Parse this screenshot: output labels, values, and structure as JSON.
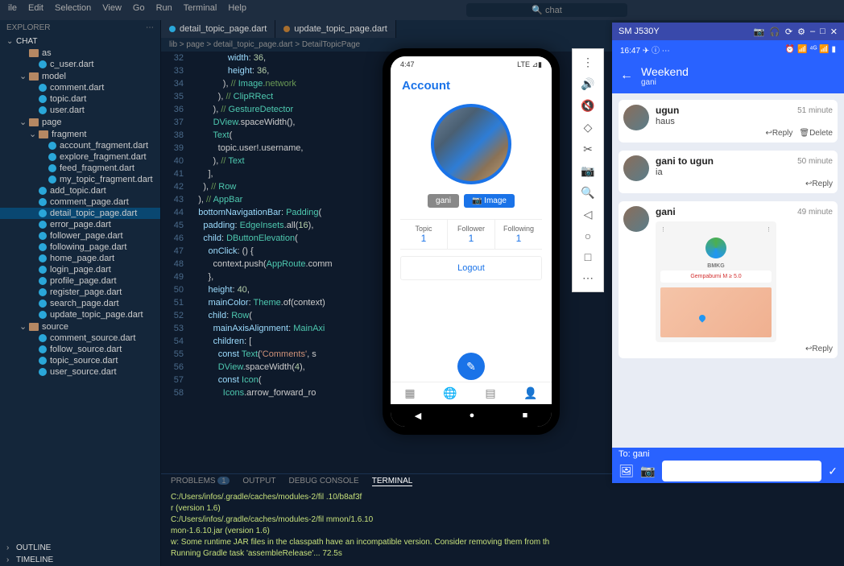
{
  "menubar": {
    "items": [
      "ile",
      "Edit",
      "Selection",
      "View",
      "Go",
      "Run",
      "Terminal",
      "Help"
    ],
    "search": "chat"
  },
  "explorer": {
    "title": "EXPLORER",
    "project": "CHAT",
    "outline": "OUTLINE",
    "timeline": "TIMELINE"
  },
  "tree": [
    {
      "l": "as",
      "ind": 1,
      "icon": "folder"
    },
    {
      "l": "c_user.dart",
      "ind": 2,
      "icon": "dart"
    },
    {
      "l": "model",
      "ind": 1,
      "icon": "folder",
      "chev": "v"
    },
    {
      "l": "comment.dart",
      "ind": 2,
      "icon": "dart"
    },
    {
      "l": "topic.dart",
      "ind": 2,
      "icon": "dart"
    },
    {
      "l": "user.dart",
      "ind": 2,
      "icon": "dart"
    },
    {
      "l": "page",
      "ind": 1,
      "icon": "folder",
      "chev": "v"
    },
    {
      "l": "fragment",
      "ind": 2,
      "icon": "folder",
      "chev": "v"
    },
    {
      "l": "account_fragment.dart",
      "ind": 3,
      "icon": "dart"
    },
    {
      "l": "explore_fragment.dart",
      "ind": 3,
      "icon": "dart"
    },
    {
      "l": "feed_fragment.dart",
      "ind": 3,
      "icon": "dart"
    },
    {
      "l": "my_topic_fragment.dart",
      "ind": 3,
      "icon": "dart"
    },
    {
      "l": "add_topic.dart",
      "ind": 2,
      "icon": "dart"
    },
    {
      "l": "comment_page.dart",
      "ind": 2,
      "icon": "dart"
    },
    {
      "l": "detail_topic_page.dart",
      "ind": 2,
      "icon": "dart",
      "sel": true
    },
    {
      "l": "error_page.dart",
      "ind": 2,
      "icon": "dart"
    },
    {
      "l": "follower_page.dart",
      "ind": 2,
      "icon": "dart"
    },
    {
      "l": "following_page.dart",
      "ind": 2,
      "icon": "dart"
    },
    {
      "l": "home_page.dart",
      "ind": 2,
      "icon": "dart"
    },
    {
      "l": "login_page.dart",
      "ind": 2,
      "icon": "dart"
    },
    {
      "l": "profile_page.dart",
      "ind": 2,
      "icon": "dart"
    },
    {
      "l": "register_page.dart",
      "ind": 2,
      "icon": "dart"
    },
    {
      "l": "search_page.dart",
      "ind": 2,
      "icon": "dart"
    },
    {
      "l": "update_topic_page.dart",
      "ind": 2,
      "icon": "dart"
    },
    {
      "l": "source",
      "ind": 1,
      "icon": "folder",
      "chev": "v"
    },
    {
      "l": "comment_source.dart",
      "ind": 2,
      "icon": "dart"
    },
    {
      "l": "follow_source.dart",
      "ind": 2,
      "icon": "dart"
    },
    {
      "l": "topic_source.dart",
      "ind": 2,
      "icon": "dart"
    },
    {
      "l": "user_source.dart",
      "ind": 2,
      "icon": "dart"
    }
  ],
  "tabs": [
    {
      "label": "detail_topic_page.dart",
      "icon": "dart"
    },
    {
      "label": "update_topic_page.dart",
      "icon": "dart2"
    }
  ],
  "breadcrumb": "lib > page > detail_topic_page.dart > DetailTopicPage",
  "code": {
    "start": 32,
    "lines": [
      "                width: 36,",
      "                height: 36,",
      "              ), // Image.network",
      "            ), // ClipRRect",
      "          ), // GestureDetector",
      "          DView.spaceWidth(),",
      "          Text(",
      "            topic.user!.username,",
      "          ), // Text",
      "        ],",
      "      ), // Row",
      "    ), // AppBar",
      "    bottomNavigationBar: Padding(",
      "      padding: EdgeInsets.all(16),",
      "      child: DButtonElevation(",
      "        onClick: () {",
      "          context.push(AppRoute.comm",
      "        },",
      "        height: 40,",
      "        mainColor: Theme.of(context)",
      "        child: Row(",
      "          mainAxisAlignment: MainAxi",
      "          children: [",
      "            const Text('Comments', s",
      "            DView.spaceWidth(4),",
      "            const Icon(",
      "              Icons.arrow_forward_ro"
    ]
  },
  "term": {
    "tabs": [
      "PROBLEMS",
      "OUTPUT",
      "DEBUG CONSOLE",
      "TERMINAL"
    ],
    "badge": "1",
    "lines": [
      "C:/Users/infos/.gradle/caches/modules-2/fil                                       .10/b8af3f",
      "r (version 1.6)",
      "C:/Users/infos/.gradle/caches/modules-2/fil                                       mmon/1.6.10",
      "mon-1.6.10.jar (version 1.6)",
      "w: Some runtime JAR files in the classpath have an incompatible version. Consider removing them from th",
      "Running Gradle task 'assembleRelease'...                   72.5s"
    ]
  },
  "toolbar": [
    "⋮",
    "🔊",
    "🔇",
    "◇",
    "✂",
    "📷",
    "🔍",
    "◁",
    "○",
    "□",
    "⋯"
  ],
  "phone1": {
    "time": "4:47",
    "net": "LTE ⊿▮",
    "title": "Account",
    "userBtn": "gani",
    "imgBtn": "Image",
    "stats": [
      {
        "l": "Topic",
        "v": "1"
      },
      {
        "l": "Follower",
        "v": "1"
      },
      {
        "l": "Following",
        "v": "1"
      }
    ],
    "logout": "Logout",
    "nav": [
      "▦",
      "🌐",
      "▤",
      "👤"
    ]
  },
  "phone2": {
    "winTitle": "SM J530Y",
    "winIcons": [
      "📷",
      "🎧",
      "⟳",
      "⚙"
    ],
    "statusTime": "16:47",
    "statusIcons": "✈ ⓘ ⋯",
    "statusRight": "⏰ 📶 ⁴ᴳ 📶 ▮",
    "back": "←",
    "title": "Weekend",
    "sub": "gani",
    "msgs": [
      {
        "name": "ugun",
        "txt": "haus",
        "time": "51 minute",
        "actions": [
          "↩Reply",
          "🗑Delete"
        ]
      },
      {
        "name": "gani to ugun",
        "txt": "ia",
        "time": "50 minute",
        "actions": [
          "↩Reply"
        ]
      },
      {
        "name": "gani",
        "txt": "",
        "time": "49 minute",
        "img": true,
        "imgLbl": "BMKG",
        "imgAlert": "Gempabumi M ≥ 5.0",
        "actions": [
          "↩Reply"
        ]
      }
    ],
    "to": "To: gani",
    "icons": [
      "🖼",
      "📷"
    ],
    "send": "✓"
  }
}
